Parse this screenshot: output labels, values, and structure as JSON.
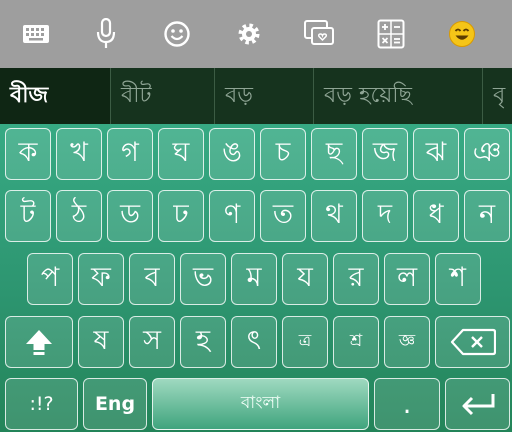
{
  "toolbar": {
    "icons": [
      "keyboard-icon",
      "microphone-icon",
      "smiley-icon",
      "gear-icon",
      "sticker-icon",
      "calculator-icon",
      "emoji-icon"
    ]
  },
  "suggestions": [
    "বীজ",
    "বীট",
    "বড়",
    "বড় হয়েছি",
    "বৃ"
  ],
  "rows": [
    [
      "ক",
      "খ",
      "গ",
      "ঘ",
      "ঙ",
      "চ",
      "ছ",
      "জ",
      "ঝ",
      "ঞ"
    ],
    [
      "ট",
      "ঠ",
      "ড",
      "ঢ",
      "ণ",
      "ত",
      "থ",
      "দ",
      "ধ",
      "ন"
    ],
    [
      "প",
      "ফ",
      "ব",
      "ভ",
      "ম",
      "য",
      "র",
      "ল",
      "শ"
    ],
    [
      "ষ",
      "স",
      "হ",
      "ৎ",
      "ত্র",
      "শ্র",
      "জ্ঞ"
    ]
  ],
  "bottom": {
    "symbols": ":!?",
    "lang": "Eng",
    "space": "বাংলা",
    "period": "."
  },
  "colors": {
    "toolbar": "#9e9e9e",
    "suggestion_bar": "#16331e",
    "keyboard": "#2e8f6c",
    "emoji": "#f5c518"
  }
}
